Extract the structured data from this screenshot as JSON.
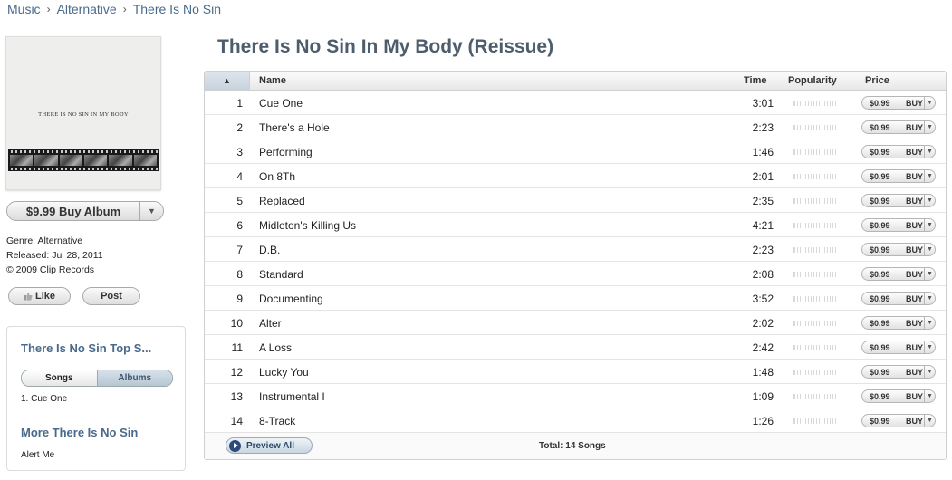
{
  "breadcrumb": [
    "Music",
    "Alternative",
    "There Is No Sin"
  ],
  "breadcrumb_sep": "›",
  "album": {
    "art_text": "THERE IS NO SIN IN MY BODY",
    "title": "There Is No Sin In My Body (Reissue)",
    "buy_label": "$9.99 Buy Album",
    "genre": "Genre: Alternative",
    "released": "Released: Jul 28, 2011",
    "copyright": "© 2009 Clip Records"
  },
  "social": {
    "like": "Like",
    "post": "Post"
  },
  "sidebar": {
    "top_title": "There Is No Sin Top S...",
    "tab_songs": "Songs",
    "tab_albums": "Albums",
    "top_item": "1. Cue One",
    "more_title": "More There Is No Sin",
    "alert": "Alert Me"
  },
  "table": {
    "sort_glyph": "▲",
    "col_name": "Name",
    "col_time": "Time",
    "col_popularity": "Popularity",
    "col_price": "Price",
    "tracks": [
      {
        "num": "1",
        "name": "Cue One",
        "time": "3:01",
        "price": "$0.99",
        "buy": "BUY"
      },
      {
        "num": "2",
        "name": "There's a Hole",
        "time": "2:23",
        "price": "$0.99",
        "buy": "BUY"
      },
      {
        "num": "3",
        "name": "Performing",
        "time": "1:46",
        "price": "$0.99",
        "buy": "BUY"
      },
      {
        "num": "4",
        "name": "On 8Th",
        "time": "2:01",
        "price": "$0.99",
        "buy": "BUY"
      },
      {
        "num": "5",
        "name": "Replaced",
        "time": "2:35",
        "price": "$0.99",
        "buy": "BUY"
      },
      {
        "num": "6",
        "name": "Midleton's Killing Us",
        "time": "4:21",
        "price": "$0.99",
        "buy": "BUY"
      },
      {
        "num": "7",
        "name": "D.B.",
        "time": "2:23",
        "price": "$0.99",
        "buy": "BUY"
      },
      {
        "num": "8",
        "name": "Standard",
        "time": "2:08",
        "price": "$0.99",
        "buy": "BUY"
      },
      {
        "num": "9",
        "name": "Documenting",
        "time": "3:52",
        "price": "$0.99",
        "buy": "BUY"
      },
      {
        "num": "10",
        "name": "Alter",
        "time": "2:02",
        "price": "$0.99",
        "buy": "BUY"
      },
      {
        "num": "11",
        "name": "A Loss",
        "time": "2:42",
        "price": "$0.99",
        "buy": "BUY"
      },
      {
        "num": "12",
        "name": "Lucky You",
        "time": "1:48",
        "price": "$0.99",
        "buy": "BUY"
      },
      {
        "num": "13",
        "name": "Instrumental I",
        "time": "1:09",
        "price": "$0.99",
        "buy": "BUY"
      },
      {
        "num": "14",
        "name": "8-Track",
        "time": "1:26",
        "price": "$0.99",
        "buy": "BUY"
      }
    ],
    "preview_all": "Preview All",
    "total": "Total: 14 Songs"
  },
  "colors": {
    "link": "#4a6a8c",
    "title": "#4d5d6c",
    "accent": "#2d4a7a"
  },
  "icons": {
    "like": "thumbs-up-icon",
    "preview": "play-icon",
    "dropdown": "chevron-down-icon"
  }
}
